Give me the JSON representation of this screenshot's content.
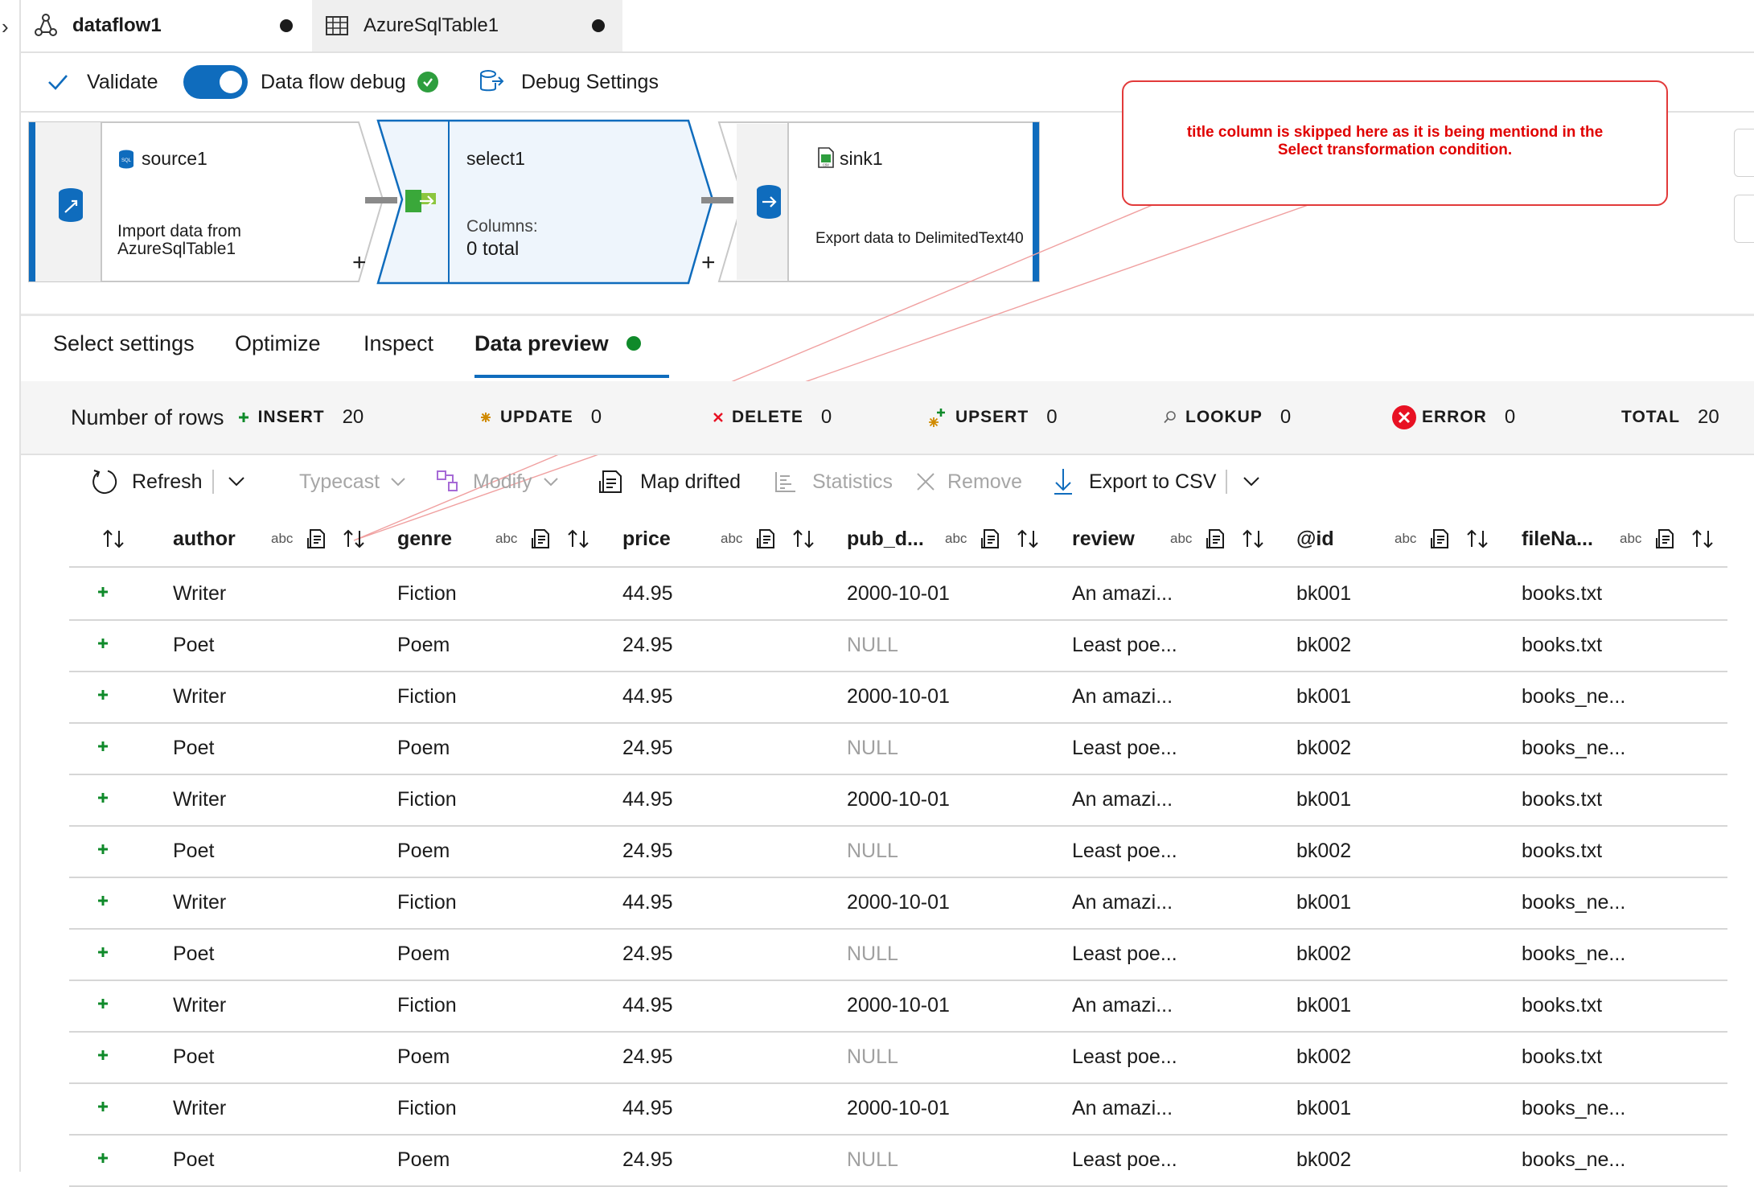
{
  "tabs": [
    {
      "label": "dataflow1",
      "icon": "dataflow-icon"
    },
    {
      "label": "AzureSqlTable1",
      "icon": "table-icon"
    }
  ],
  "toolbar": {
    "validate": "Validate",
    "debug_toggle": "Data flow debug",
    "debug_settings": "Debug Settings"
  },
  "nodes": {
    "source": {
      "title": "source1",
      "desc_line1": "Import data from",
      "desc_line2": "AzureSqlTable1"
    },
    "select": {
      "title": "select1",
      "columns_label": "Columns:",
      "columns_value": "0 total"
    },
    "sink": {
      "title": "sink1",
      "desc": "Export data to DelimitedText40"
    }
  },
  "callout": {
    "text_line1": "title column is skipped here as it is being mentiond in the",
    "text_line2": "Select transformation condition.",
    "color": "#e00000"
  },
  "settings_tabs": [
    {
      "label": "Select settings"
    },
    {
      "label": "Optimize"
    },
    {
      "label": "Inspect"
    },
    {
      "label": "Data preview"
    }
  ],
  "stats": {
    "rows_label": "Number of rows",
    "insert": {
      "label": "INSERT",
      "value": "20"
    },
    "update": {
      "label": "UPDATE",
      "value": "0"
    },
    "delete": {
      "label": "DELETE",
      "value": "0"
    },
    "upsert": {
      "label": "UPSERT",
      "value": "0"
    },
    "lookup": {
      "label": "LOOKUP",
      "value": "0"
    },
    "error": {
      "label": "ERROR",
      "value": "0"
    },
    "total": {
      "label": "TOTAL",
      "value": "20"
    }
  },
  "actions": {
    "refresh": "Refresh",
    "typecast": "Typecast",
    "modify": "Modify",
    "map_drifted": "Map drifted",
    "statistics": "Statistics",
    "remove": "Remove",
    "export": "Export to CSV"
  },
  "columns": [
    {
      "name": "author",
      "type": "abc"
    },
    {
      "name": "genre",
      "type": "abc"
    },
    {
      "name": "price",
      "type": "abc"
    },
    {
      "name": "pub_d...",
      "type": "abc"
    },
    {
      "name": "review",
      "type": "abc"
    },
    {
      "name": "@id",
      "type": "abc"
    },
    {
      "name": "fileNa...",
      "type": "abc"
    }
  ],
  "rows": [
    [
      "Writer",
      "Fiction",
      "44.95",
      "2000-10-01",
      "An amazi...",
      "bk001",
      "books.txt"
    ],
    [
      "Poet",
      "Poem",
      "24.95",
      "NULL",
      "Least poe...",
      "bk002",
      "books.txt"
    ],
    [
      "Writer",
      "Fiction",
      "44.95",
      "2000-10-01",
      "An amazi...",
      "bk001",
      "books_ne..."
    ],
    [
      "Poet",
      "Poem",
      "24.95",
      "NULL",
      "Least poe...",
      "bk002",
      "books_ne..."
    ],
    [
      "Writer",
      "Fiction",
      "44.95",
      "2000-10-01",
      "An amazi...",
      "bk001",
      "books.txt"
    ],
    [
      "Poet",
      "Poem",
      "24.95",
      "NULL",
      "Least poe...",
      "bk002",
      "books.txt"
    ],
    [
      "Writer",
      "Fiction",
      "44.95",
      "2000-10-01",
      "An amazi...",
      "bk001",
      "books_ne..."
    ],
    [
      "Poet",
      "Poem",
      "24.95",
      "NULL",
      "Least poe...",
      "bk002",
      "books_ne..."
    ],
    [
      "Writer",
      "Fiction",
      "44.95",
      "2000-10-01",
      "An amazi...",
      "bk001",
      "books.txt"
    ],
    [
      "Poet",
      "Poem",
      "24.95",
      "NULL",
      "Least poe...",
      "bk002",
      "books.txt"
    ],
    [
      "Writer",
      "Fiction",
      "44.95",
      "2000-10-01",
      "An amazi...",
      "bk001",
      "books_ne..."
    ],
    [
      "Poet",
      "Poem",
      "24.95",
      "NULL",
      "Least poe...",
      "bk002",
      "books_ne..."
    ]
  ],
  "colors": {
    "accent": "#0f6cbd",
    "success": "#2e9e3e",
    "insert": "#0f8a2a",
    "error": "#e81123",
    "callout_border": "#e23a3a"
  }
}
